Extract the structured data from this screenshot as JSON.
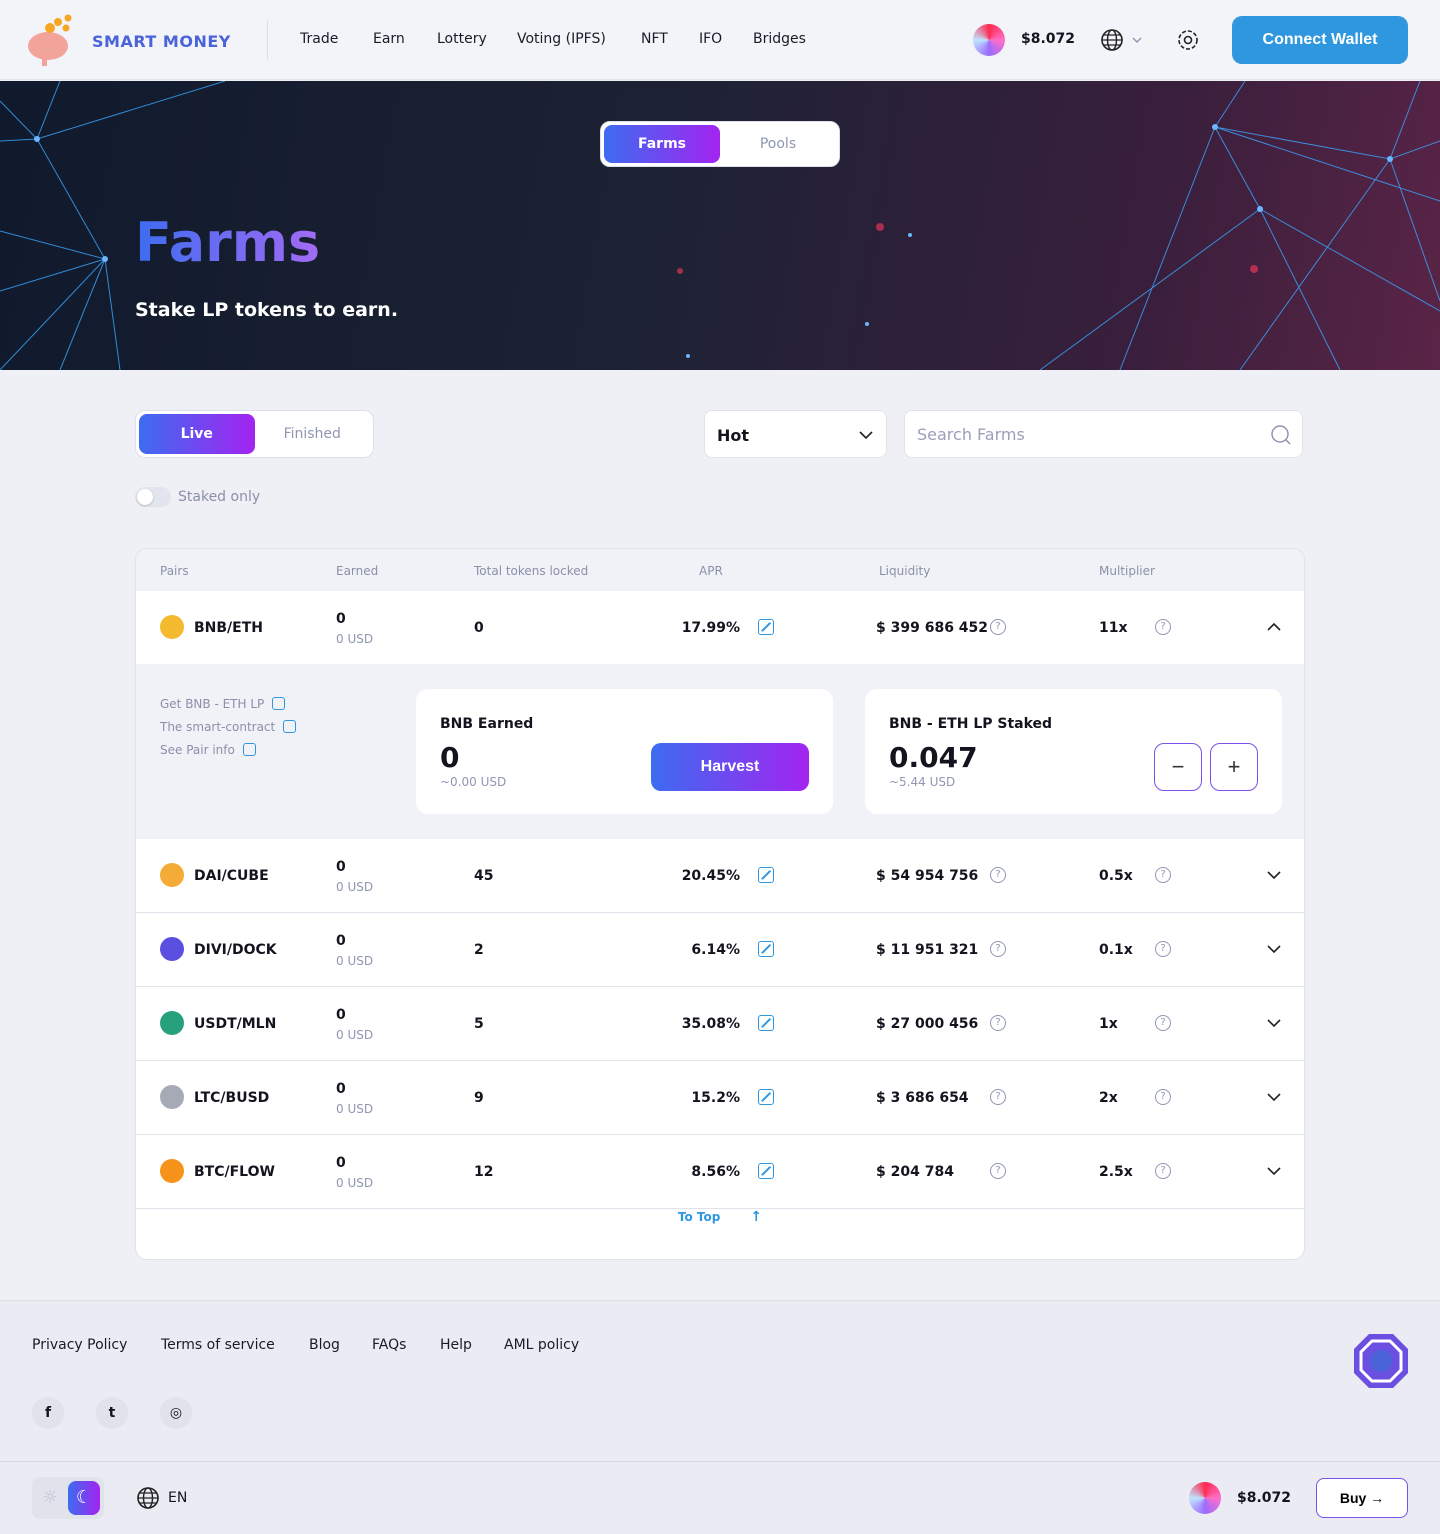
{
  "header": {
    "logo": "SMART MONEY",
    "nav": [
      "Trade",
      "Earn",
      "Lottery",
      "Voting (IPFS)",
      "NFT",
      "IFO",
      "Bridges"
    ],
    "price": "$8.072",
    "connect": "Connect Wallet"
  },
  "hero": {
    "tabs": [
      "Farms",
      "Pools"
    ],
    "active_tab": "Farms",
    "title": "Farms",
    "subtitle": "Stake LP tokens to earn."
  },
  "filters": {
    "tabs": [
      "Live",
      "Finished"
    ],
    "active": "Live",
    "sort": "Hot",
    "search_placeholder": "Search Farms",
    "staked_only": "Staked only",
    "staked_only_on": false
  },
  "table": {
    "headers": [
      "Pairs",
      "Earned",
      "Total tokens locked",
      "APR",
      "Liquidity",
      "Multiplier"
    ],
    "rows": [
      {
        "pair": "BNB/ETH",
        "earned": "0",
        "earned_usd": "0 USD",
        "total": "0",
        "apr": "17.99%",
        "liquidity": "$ 399 686 452",
        "multiplier": "11x",
        "coin": "#f3ba2f",
        "expanded": true
      },
      {
        "pair": "DAI/CUBE",
        "earned": "0",
        "earned_usd": "0 USD",
        "total": "45",
        "apr": "20.45%",
        "liquidity": "$ 54 954 756",
        "multiplier": "0.5x",
        "coin": "#f5ac37"
      },
      {
        "pair": "DIVI/DOCK",
        "earned": "0",
        "earned_usd": "0 USD",
        "total": "2",
        "apr": "6.14%",
        "liquidity": "$ 11 951 321",
        "multiplier": "0.1x",
        "coin": "#5a4fe0"
      },
      {
        "pair": "USDT/MLN",
        "earned": "0",
        "earned_usd": "0 USD",
        "total": "5",
        "apr": "35.08%",
        "liquidity": "$ 27 000 456",
        "multiplier": "1x",
        "coin": "#26a17b"
      },
      {
        "pair": "LTC/BUSD",
        "earned": "0",
        "earned_usd": "0 USD",
        "total": "9",
        "apr": "15.2%",
        "liquidity": "$ 3 686 654",
        "multiplier": "2x",
        "coin": "#a6a9b6"
      },
      {
        "pair": "BTC/FLOW",
        "earned": "0",
        "earned_usd": "0 USD",
        "total": "12",
        "apr": "8.56%",
        "liquidity": "$ 204 784",
        "multiplier": "2.5x",
        "coin": "#f7931a"
      }
    ],
    "details": {
      "links": [
        "Get BNB - ETH LP",
        "The smart-contract",
        "See Pair info"
      ],
      "earned_title": "BNB Earned",
      "earned_value": "0",
      "earned_usd": "~0.00 USD",
      "harvest": "Harvest",
      "staked_title": "BNB - ETH LP Staked",
      "staked_value": "0.047",
      "staked_usd": "~5.44 USD"
    },
    "to_top": "To Top"
  },
  "footer": {
    "links": [
      "Privacy Policy",
      "Terms of service",
      "Blog",
      "FAQs",
      "Help",
      "AML policy"
    ],
    "lang": "EN",
    "price": "$8.072",
    "buy": "Buy"
  }
}
